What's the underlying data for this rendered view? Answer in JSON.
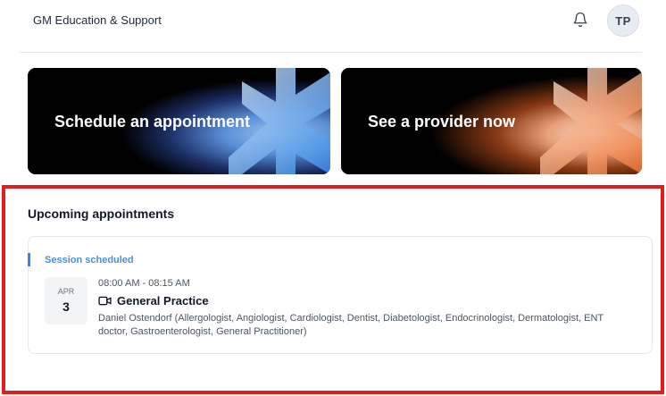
{
  "header": {
    "brand": "GM Education & Support",
    "avatar_initials": "TP",
    "bell_icon": "bell-icon"
  },
  "cards": [
    {
      "title": "Schedule an appointment",
      "accent": "#4a90e2"
    },
    {
      "title": "See a provider now",
      "accent": "#f47a3b"
    }
  ],
  "upcoming": {
    "section_title": "Upcoming appointments",
    "highlight_color": "#e11d1d",
    "appointment": {
      "status": "Session scheduled",
      "month": "APR",
      "day": "3",
      "time": "08:00 AM - 08:15 AM",
      "type": "General Practice",
      "type_icon": "video-icon",
      "provider": "Daniel Ostendorf (Allergologist, Angiologist, Cardiologist, Dentist, Diabetologist, Endocrinologist, Dermatologist, ENT doctor, Gastroenterologist, General Practitioner)"
    }
  }
}
